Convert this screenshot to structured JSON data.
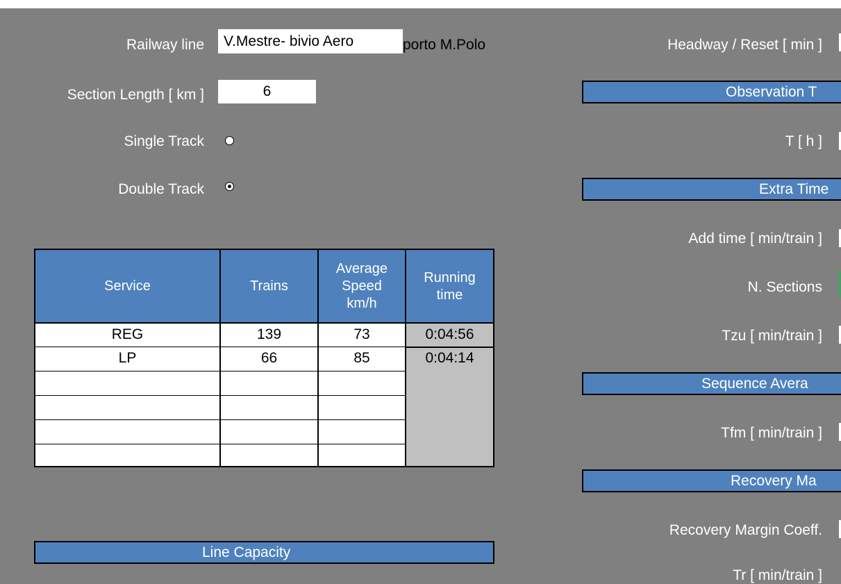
{
  "top_fields": {
    "railway_line_label": "Railway line",
    "railway_line_value_part1": "V.Mestre- bivio Aero",
    "railway_line_value_part2": "porto M.Polo",
    "section_length_label": "Section Length [ km ]",
    "section_length_value": "6",
    "single_track_label": "Single Track",
    "double_track_label": "Double Track",
    "track_selected": "Double Track"
  },
  "table": {
    "headers": [
      "Service",
      "Trains",
      "Average Speed km/h",
      "Running time"
    ],
    "rows": [
      {
        "service": "REG",
        "trains": "139",
        "speed": "73",
        "time": "0:04:56"
      },
      {
        "service": "LP",
        "trains": "66",
        "speed": "85",
        "time": "0:04:14"
      },
      {
        "service": "",
        "trains": "",
        "speed": "",
        "time": ""
      },
      {
        "service": "",
        "trains": "",
        "speed": "",
        "time": ""
      },
      {
        "service": "",
        "trains": "",
        "speed": "",
        "time": ""
      },
      {
        "service": "",
        "trains": "",
        "speed": "",
        "time": ""
      }
    ]
  },
  "line_capacity_label": "Line Capacity",
  "right_panel": {
    "headway_label": "Headway / Reset [ min ]",
    "observation_header": "Observation T",
    "t_label": "T [ h ]",
    "extra_time_header": "Extra Time",
    "add_time_label": "Add time [ min/train ]",
    "n_sections_label": "N. Sections",
    "tzu_label": "Tzu [ min/train ]",
    "sequence_header": "Sequence Avera",
    "tfm_label": "Tfm [ min/train ]",
    "recovery_header": "Recovery Ma",
    "recovery_coeff_label": "Recovery Margin Coeff.",
    "tr_label_partial": "Tr [ min/train ]"
  },
  "colors": {
    "background": "#808080",
    "header_blue": "#4f81bd",
    "running_time_grey": "#c0c0c0",
    "n_sections_accent": "#3aa760"
  }
}
